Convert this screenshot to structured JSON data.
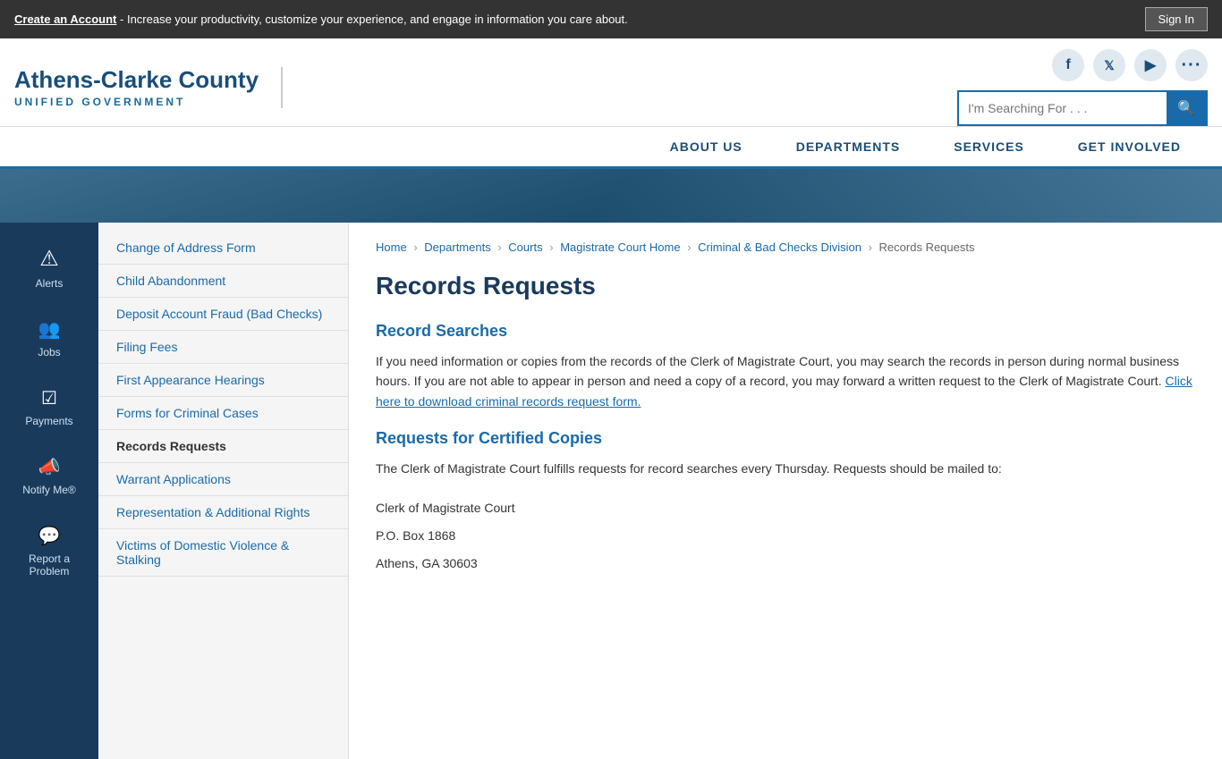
{
  "topBanner": {
    "message": "Create an Account",
    "messageDetail": " - Increase your productivity, customize your experience, and engage in information you care about.",
    "signInLabel": "Sign In"
  },
  "header": {
    "logoTitle": "Athens-Clarke County",
    "logoSubtitle": "UNIFIED GOVERNMENT",
    "socialIcons": [
      {
        "name": "facebook-icon",
        "glyph": "f"
      },
      {
        "name": "twitter-icon",
        "glyph": "t"
      },
      {
        "name": "youtube-icon",
        "glyph": "▶"
      },
      {
        "name": "more-icon",
        "glyph": "···"
      }
    ],
    "searchPlaceholder": "I'm Searching For . . ."
  },
  "nav": {
    "items": [
      {
        "label": "ABOUT US",
        "name": "about-us"
      },
      {
        "label": "DEPARTMENTS",
        "name": "departments"
      },
      {
        "label": "SERVICES",
        "name": "services"
      },
      {
        "label": "GET INVOLVED",
        "name": "get-involved"
      }
    ]
  },
  "iconSidebar": {
    "items": [
      {
        "label": "Alerts",
        "glyph": "⚠",
        "name": "alerts-icon"
      },
      {
        "label": "Jobs",
        "glyph": "👥",
        "name": "jobs-icon"
      },
      {
        "label": "Payments",
        "glyph": "☑",
        "name": "payments-icon"
      },
      {
        "label": "Notify Me®",
        "glyph": "📣",
        "name": "notify-icon"
      },
      {
        "label": "Report a Problem",
        "glyph": "💬",
        "name": "report-icon"
      }
    ]
  },
  "navSidebar": {
    "items": [
      {
        "label": "Change of Address Form",
        "name": "change-of-address",
        "active": false
      },
      {
        "label": "Child Abandonment",
        "name": "child-abandonment",
        "active": false
      },
      {
        "label": "Deposit Account Fraud (Bad Checks)",
        "name": "deposit-fraud",
        "active": false
      },
      {
        "label": "Filing Fees",
        "name": "filing-fees",
        "active": false
      },
      {
        "label": "First Appearance Hearings",
        "name": "first-appearance",
        "active": false
      },
      {
        "label": "Forms for Criminal Cases",
        "name": "forms-criminal",
        "active": false
      },
      {
        "label": "Records Requests",
        "name": "records-requests",
        "active": true
      },
      {
        "label": "Warrant Applications",
        "name": "warrant-apps",
        "active": false
      },
      {
        "label": "Representation & Additional Rights",
        "name": "representation",
        "active": false
      },
      {
        "label": "Victims of Domestic Violence & Stalking",
        "name": "victims",
        "active": false
      }
    ]
  },
  "breadcrumb": {
    "items": [
      {
        "label": "Home",
        "href": "#"
      },
      {
        "label": "Departments",
        "href": "#"
      },
      {
        "label": "Courts",
        "href": "#"
      },
      {
        "label": "Magistrate Court Home",
        "href": "#"
      },
      {
        "label": "Criminal & Bad Checks Division",
        "href": "#"
      },
      {
        "label": "Records Requests",
        "href": null
      }
    ]
  },
  "content": {
    "pageTitle": "Records Requests",
    "sections": [
      {
        "title": "Record Searches",
        "text": "If you need information or copies from the records of the Clerk of Magistrate Court, you may search the records in person during normal business hours. If you are not able to appear in person and need a copy of a record, you may forward a written request to the Clerk of Magistrate Court.",
        "linkText": "Click here to download criminal records request form.",
        "linkHref": "#"
      },
      {
        "title": "Requests for Certified Copies",
        "text": "The Clerk of Magistrate Court fulfills requests for record searches every Thursday. Requests should be mailed to:"
      }
    ],
    "address": {
      "line1": "Clerk of Magistrate Court",
      "line2": "P.O. Box 1868",
      "line3": "Athens, GA 30603"
    }
  }
}
